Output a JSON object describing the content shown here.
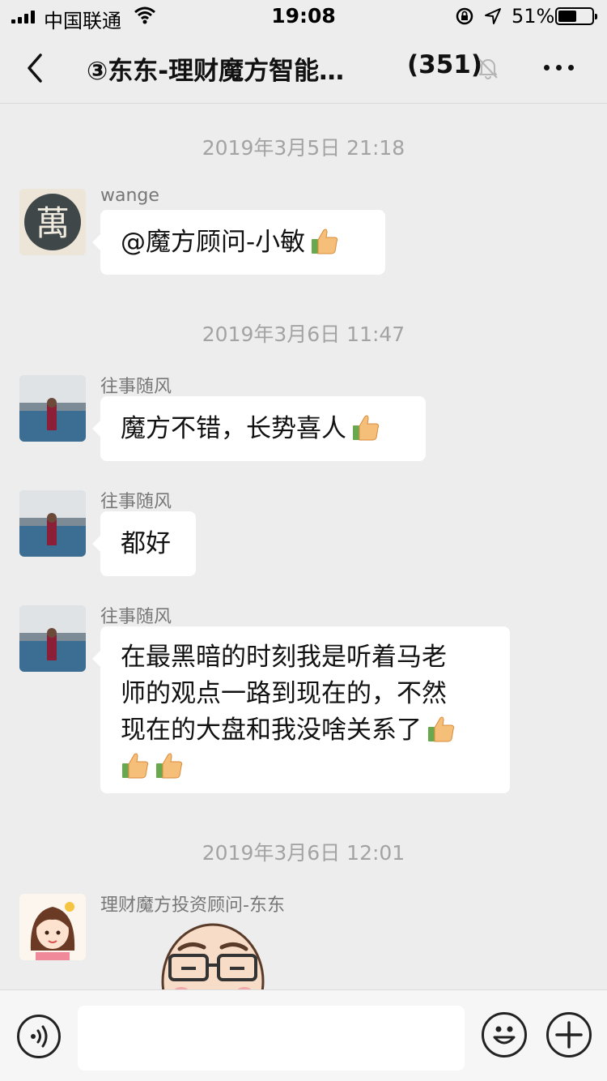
{
  "status_bar": {
    "carrier": "中国联通",
    "time": "19:08",
    "battery": "51%",
    "battery_level": 0.51
  },
  "header": {
    "title": "③东东-理财魔方智能…",
    "member_count": "(351)"
  },
  "messages": [
    {
      "timestamp": "2019年3月5日 21:18"
    },
    {
      "sender": "wange",
      "text": "@魔方顾问-小敏",
      "emoji": "thumbs-up"
    },
    {
      "timestamp": "2019年3月6日 11:47"
    },
    {
      "sender": "往事随风",
      "text": "魔方不错，长势喜人",
      "emoji": "thumbs-up"
    },
    {
      "sender": "往事随风",
      "text": "都好"
    },
    {
      "sender": "往事随风",
      "lines": [
        "在最黑暗的时刻我是听着马老",
        "师的观点一路到现在的，不然",
        "现在的大盘和我没啥关系了"
      ],
      "emoji": "thumbs-up x3"
    },
    {
      "timestamp": "2019年3月6日 12:01"
    },
    {
      "sender": "理财魔方投资顾问-东东",
      "sticker": "cartoon-face-with-glasses"
    }
  ],
  "input": {
    "value": ""
  },
  "colors": {
    "background": "#ededed",
    "bubble": "#ffffff",
    "meta_text": "#a3a3a3"
  }
}
